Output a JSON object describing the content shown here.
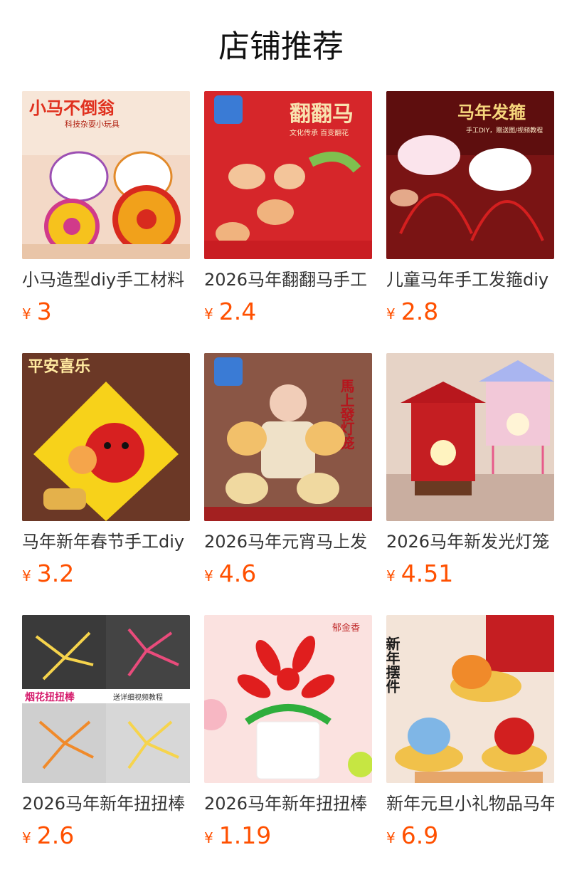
{
  "section": {
    "title": "店铺推荐"
  },
  "currency_symbol": "¥",
  "products": [
    {
      "name": "小马造型diy手工材料",
      "price": "3",
      "image_icon": "horse-wheel-toy-image",
      "overlay": "小马不倒翁",
      "sub": "科技杂耍小玩具"
    },
    {
      "name": "2026马年翻翻马手工",
      "price": "2.4",
      "image_icon": "flip-horse-craft-image",
      "overlay": "翻翻马",
      "sub": "文化传承 百变翻花"
    },
    {
      "name": "儿童马年手工发箍diy",
      "price": "2.8",
      "image_icon": "horse-headband-image",
      "overlay": "马年发箍",
      "sub": "手工DIY，赠送图/视频教程"
    },
    {
      "name": "马年新年春节手工diy",
      "price": "3.2",
      "image_icon": "peace-joy-plaque-image",
      "overlay": "平安喜乐",
      "sub": ""
    },
    {
      "name": "2026马年元宵马上发",
      "price": "4.6",
      "image_icon": "horse-lantern-image",
      "overlay": "馬上發灯笼",
      "sub": ""
    },
    {
      "name": "2026马年新发光灯笼",
      "price": "4.51",
      "image_icon": "pavilion-lantern-image",
      "overlay": "",
      "sub": ""
    },
    {
      "name": "2026马年新年扭扭棒",
      "price": "2.6",
      "image_icon": "firework-twist-stick-image",
      "overlay": "烟花扭扭棒",
      "sub": "送详细视频教程"
    },
    {
      "name": "2026马年新年扭扭棒",
      "price": "1.19",
      "image_icon": "red-flower-pot-image",
      "overlay": "郁金香",
      "sub": ""
    },
    {
      "name": "新年元旦小礼物品马年",
      "price": "6.9",
      "image_icon": "horse-ornament-image",
      "overlay": "新年摆件",
      "sub": ""
    }
  ],
  "colors": {
    "price": "#ff5000",
    "title": "#111111"
  }
}
